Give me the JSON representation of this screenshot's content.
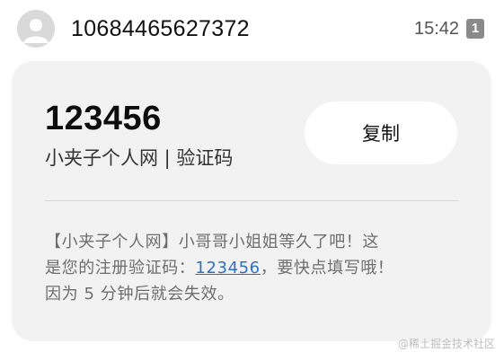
{
  "header": {
    "sender": "10684465627372",
    "time": "15:42",
    "sim_badge": "1",
    "avatar_icon": "person-icon"
  },
  "card": {
    "code": "123456",
    "source": "小夹子个人网 | 验证码",
    "copy_label": "复制",
    "message": {
      "line1": "【小夹子个人网】小哥哥小姐姐等久了吧！这",
      "line2_prefix": "是您的注册验证码：",
      "line2_code": "123456",
      "line2_suffix": "，要快点填写哦！",
      "line3": "因为 5 分钟后就会失效。"
    }
  },
  "watermark": "@稀土掘金技术社区",
  "colors": {
    "card_background": "#f2f2f2",
    "link": "#2f6fbf",
    "badge": "#8a8a8a"
  }
}
